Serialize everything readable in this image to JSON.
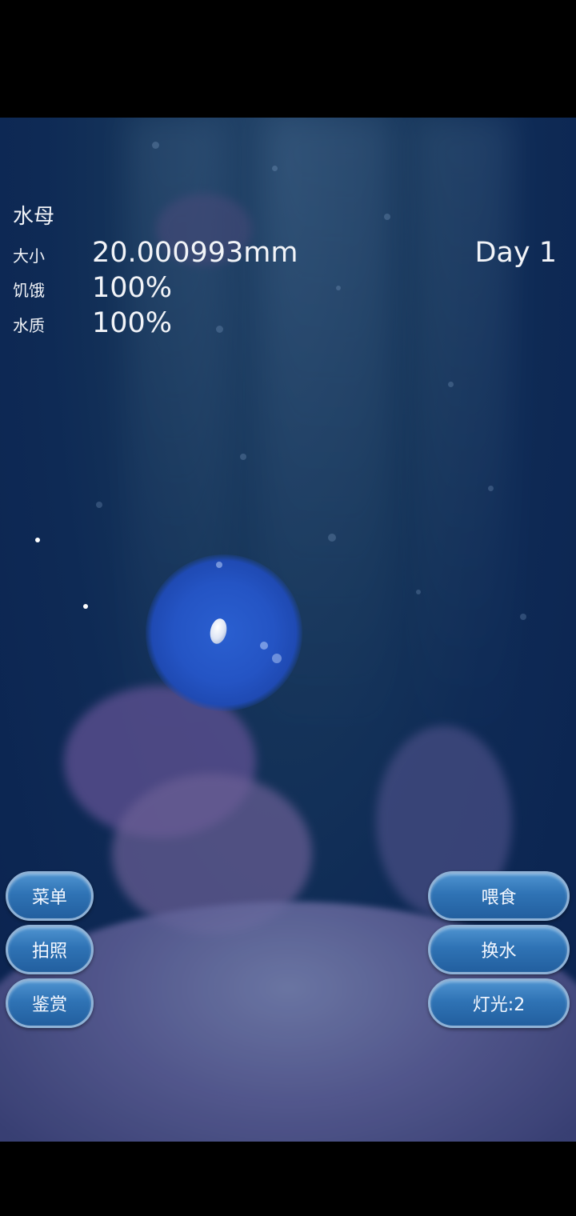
{
  "hud": {
    "title": "水母",
    "size_label": "大小",
    "size_value": "20.000993mm",
    "hunger_label": "饥饿",
    "hunger_value": "100%",
    "water_label": "水质",
    "water_value": "100%",
    "day": "Day 1"
  },
  "buttons": {
    "menu": "菜单",
    "photo": "拍照",
    "appreciate": "鉴赏",
    "feed": "喂食",
    "change_water": "换水",
    "light": "灯光:2"
  }
}
